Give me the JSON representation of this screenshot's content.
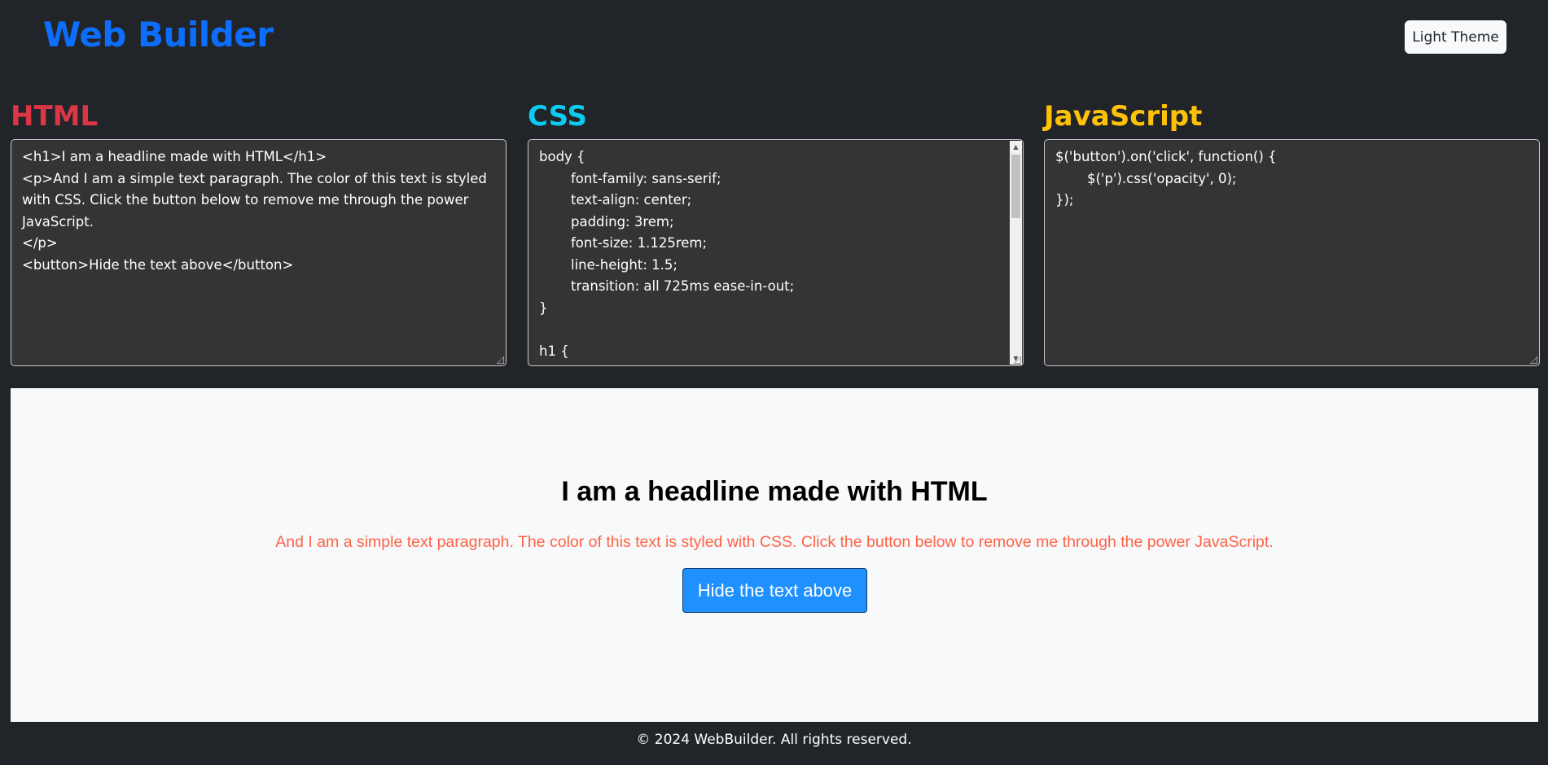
{
  "header": {
    "brand": "Web Builder",
    "theme_button_label": "Light Theme"
  },
  "editors": {
    "html": {
      "title": "HTML",
      "lines": [
        "<h1>I am a headline made with HTML</h1>",
        "<p>And I am a simple text paragraph. The color of this text is styled with CSS. Click the button below to remove me through the power JavaScript.",
        "</p>",
        "<button>Hide the text above</button>"
      ]
    },
    "css": {
      "title": "CSS",
      "lines": [
        "body {",
        "font-family: sans-serif;",
        "text-align: center;",
        "padding: 3rem;",
        "font-size: 1.125rem;",
        "line-height: 1.5;",
        "transition: all 725ms ease-in-out;",
        "}",
        "",
        "h1 {"
      ]
    },
    "js": {
      "title": "JavaScript",
      "lines": [
        "$('button').on('click', function() {",
        "$('p').css('opacity', 0);",
        "});"
      ]
    }
  },
  "preview": {
    "headline": "I am a headline made with HTML",
    "paragraph": "And I am a simple text paragraph. The color of this text is styled with CSS. Click the button below to remove me through the power JavaScript.",
    "button_label": "Hide the text above"
  },
  "footer": {
    "text": "© 2024 WebBuilder. All rights reserved."
  },
  "colors": {
    "page_bg": "#212529",
    "brand": "#0d6efd",
    "html_title": "#dc3545",
    "css_title": "#0dcaf0",
    "js_title": "#ffc107",
    "editor_bg": "#343434",
    "preview_bg": "#f8f9fa",
    "paragraph": "#ff6347",
    "preview_button": "#1e90ff"
  }
}
